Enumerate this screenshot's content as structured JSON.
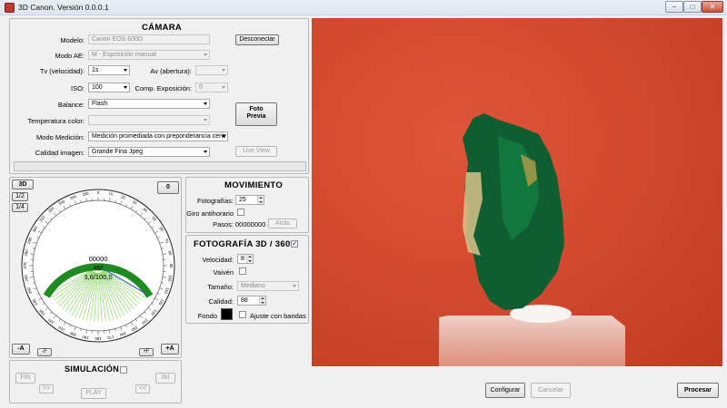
{
  "window": {
    "title": "3D Canon. Versión 0.0.0.1",
    "min_glyph": "−",
    "max_glyph": "□",
    "close_glyph": "✕"
  },
  "camera": {
    "title": "CÁMARA",
    "model_label": "Modelo:",
    "model_value": "Canon EOS 600D",
    "disconnect_label": "Desconectar",
    "ae_label": "Modo AE:",
    "ae_value": "M - Exposición manual",
    "tv_label": "Tv (velocidad):",
    "tv_value": "1s",
    "av_label": "Av (abertura):",
    "av_value": "",
    "iso_label": "ISO:",
    "iso_value": "100",
    "comp_label": "Comp. Exposición:",
    "comp_value": "0",
    "balance_label": "Balance:",
    "balance_value": "Flash",
    "preview_label_1": "Foto",
    "preview_label_2": "Previa",
    "temp_label": "Temperatura color:",
    "temp_value": "",
    "metering_label": "Modo Medición:",
    "metering_value": "Medición promediada con preponderancia centr",
    "quality_label": "Calidad imagen:",
    "quality_value": "Grande Fina Jpeg",
    "liveview_label": "Live View"
  },
  "dial": {
    "btn_3d": "3D",
    "btn_half": "1/2",
    "btn_quarter": "1/4",
    "btn_zero": "0",
    "counter": "00000",
    "angle": "45º",
    "ratio": "3,6/100,0",
    "btn_minus_a": "-A",
    "btn_minus_f": "-F",
    "btn_plus_f": "+F",
    "btn_plus_a": "+A",
    "outer_ticks": [
      "0",
      "10",
      "20",
      "30",
      "40",
      "50",
      "60",
      "70",
      "80",
      "90",
      "100",
      "110",
      "120",
      "130",
      "140",
      "150",
      "160",
      "170",
      "180",
      "190",
      "200",
      "210",
      "220",
      "230",
      "240",
      "250",
      "260",
      "270",
      "280",
      "290",
      "300",
      "310",
      "320",
      "330",
      "340",
      "350"
    ],
    "arc_color": "#1f8a1f",
    "wedge_color": "#8ed96b",
    "pointer_color": "#2a4fd0",
    "arc_fraction": 0.33
  },
  "movement": {
    "title": "MOVIMIENTO",
    "photos_label": "Fotografías:",
    "photos_value": "25",
    "ccw_label": "Giro antihorario",
    "steps_label": "Pasos:",
    "steps_value": "00000000",
    "back_label": "Atrás"
  },
  "photo3d": {
    "title": "FOTOGRAFÍA 3D / 360º",
    "speed_label": "Velocidad:",
    "speed_value": "8",
    "swing_label": "Vaivén",
    "size_label": "Tamaño:",
    "size_value": "Mediano",
    "quality_label": "Calidad:",
    "quality_value": "88",
    "background_label": "Fondo",
    "background_color": "#000000",
    "bands_label": "Ajuste con bandas"
  },
  "simulation": {
    "title": "SIMULACIÓN",
    "fin_label": "FIN",
    "ini_label": "INI",
    "fwd_label": ">>",
    "back_label": "<<",
    "play_label": "PLAY"
  },
  "footer": {
    "configure_label": "Configurar",
    "cancel_label": "Cancelar",
    "process_label": "Procesar"
  },
  "preview": {
    "background_color": "#d94a2f",
    "mineral_color": "#0d6b3a"
  }
}
